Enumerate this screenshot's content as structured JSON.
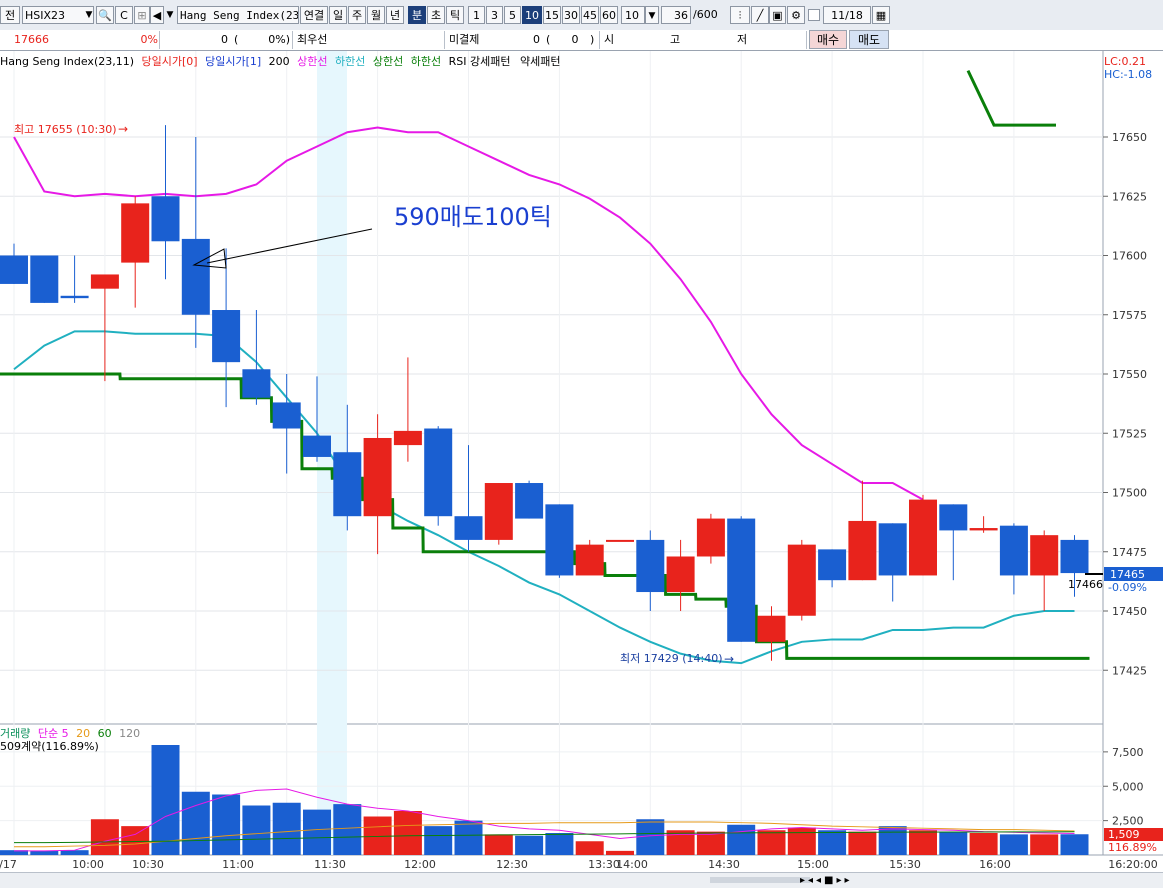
{
  "toolbar": {
    "left_label": "전",
    "code": "HSIX23",
    "instrument": "Hang Seng Index(23.1",
    "period_buttons": [
      "연결",
      "일",
      "주",
      "월",
      "년",
      "분",
      "초",
      "틱"
    ],
    "selected_period": "분",
    "interval_buttons": [
      "1",
      "3",
      "5",
      "10",
      "15",
      "30",
      "45",
      "60"
    ],
    "selected_interval": "10",
    "interval_value": "10",
    "count_value": "36",
    "count_total": "/600",
    "date_value": "11/18"
  },
  "quote_row": {
    "price": "17666",
    "change_pct": "0%",
    "volume": "0",
    "vol_pct_open": "(",
    "vol_pct": "0%)",
    "best_label": "최우선",
    "unsettled_label": "미결제",
    "unsettled_value": "0",
    "unsettled_paren_open": "(",
    "unsettled_paren_value": "0",
    "unsettled_paren_close": ")",
    "open_label": "시",
    "high_label": "고",
    "low_label": "저",
    "buy_button": "매수",
    "sell_button": "매도"
  },
  "legend": {
    "name": "Hang Seng Index(23,11)",
    "open0": "당일시가[0]",
    "open1": "당일시가[1]",
    "n200": "200",
    "upper1": "상한선",
    "lower1": "하한선",
    "upper2": "상한선",
    "lower2": "하한선",
    "rsi": "RSI 강세패턴",
    "weak": "약세패턴"
  },
  "right_info": {
    "lc": "LC:0.21",
    "hc": "HC:-1.08"
  },
  "annotations": {
    "high": "최고 17655 (10:30)",
    "low": "최저 17429 (14:40)",
    "arrow_note": "590매도100틱",
    "last_price_left": "17466",
    "last_price_tag": "17465",
    "last_change": "-0.09%"
  },
  "volume_legend": {
    "label": "거래량",
    "sma": "단순",
    "p5": "5",
    "p20": "20",
    "p60": "60",
    "p120": "120",
    "contract": "509계약(116.89%)",
    "tag_value": "1,509",
    "tag_pct": "116.89%"
  },
  "colors": {
    "up": "#e8231c",
    "down": "#1a5fd1",
    "upper_band": "#e619e6",
    "lower_band": "#20b0c0",
    "green_line": "#0a7f0a",
    "highlight": "#e6f7fd"
  },
  "chart_data": {
    "type": "candlestick",
    "y_axis": {
      "ticks": [
        "17650",
        "17625",
        "17600",
        "17575",
        "17550",
        "17525",
        "17500",
        "17475",
        "17450",
        "17425"
      ],
      "ylim": [
        17410,
        17680
      ]
    },
    "time_labels": [
      "/17",
      "10:00",
      "10:30",
      "11:00",
      "11:30",
      "12:00",
      "12:30",
      "13:30",
      "14:00",
      "14:30",
      "15:00",
      "15:30",
      "16:00",
      "16:20:00"
    ],
    "candles": [
      {
        "o": 17600,
        "h": 17605,
        "l": 17588,
        "c": 17588
      },
      {
        "o": 17600,
        "h": 17600,
        "l": 17580,
        "c": 17580
      },
      {
        "o": 17583,
        "h": 17600,
        "l": 17580,
        "c": 17582
      },
      {
        "o": 17586,
        "h": 17590,
        "l": 17547,
        "c": 17592
      },
      {
        "o": 17597,
        "h": 17625,
        "l": 17578,
        "c": 17622
      },
      {
        "o": 17625,
        "h": 17655,
        "l": 17590,
        "c": 17606
      },
      {
        "o": 17607,
        "h": 17650,
        "l": 17561,
        "c": 17575
      },
      {
        "o": 17577,
        "h": 17603,
        "l": 17536,
        "c": 17555
      },
      {
        "o": 17552,
        "h": 17577,
        "l": 17537,
        "c": 17540
      },
      {
        "o": 17538,
        "h": 17550,
        "l": 17508,
        "c": 17527
      },
      {
        "o": 17524,
        "h": 17549,
        "l": 17513,
        "c": 17515
      },
      {
        "o": 17517,
        "h": 17537,
        "l": 17484,
        "c": 17490
      },
      {
        "o": 17490,
        "h": 17533,
        "l": 17474,
        "c": 17523
      },
      {
        "o": 17520,
        "h": 17557,
        "l": 17513,
        "c": 17526
      },
      {
        "o": 17527,
        "h": 17528,
        "l": 17486,
        "c": 17490
      },
      {
        "o": 17490,
        "h": 17520,
        "l": 17475,
        "c": 17480
      },
      {
        "o": 17480,
        "h": 17504,
        "l": 17478,
        "c": 17504
      },
      {
        "o": 17504,
        "h": 17505,
        "l": 17489,
        "c": 17489
      },
      {
        "o": 17495,
        "h": 17495,
        "l": 17464,
        "c": 17465
      },
      {
        "o": 17465,
        "h": 17480,
        "l": 17466,
        "c": 17478
      },
      {
        "o": 17480,
        "h": 17480,
        "l": 17480,
        "c": 17480
      },
      {
        "o": 17480,
        "h": 17484,
        "l": 17450,
        "c": 17458
      },
      {
        "o": 17458,
        "h": 17480,
        "l": 17450,
        "c": 17473
      },
      {
        "o": 17473,
        "h": 17491,
        "l": 17470,
        "c": 17489
      },
      {
        "o": 17489,
        "h": 17490,
        "l": 17437,
        "c": 17437
      },
      {
        "o": 17437,
        "h": 17452,
        "l": 17429,
        "c": 17448
      },
      {
        "o": 17448,
        "h": 17480,
        "l": 17446,
        "c": 17478
      },
      {
        "o": 17476,
        "h": 17476,
        "l": 17460,
        "c": 17463
      },
      {
        "o": 17463,
        "h": 17505,
        "l": 17463,
        "c": 17488
      },
      {
        "o": 17487,
        "h": 17487,
        "l": 17454,
        "c": 17465
      },
      {
        "o": 17465,
        "h": 17499,
        "l": 17465,
        "c": 17497
      },
      {
        "o": 17495,
        "h": 17495,
        "l": 17463,
        "c": 17484
      },
      {
        "o": 17484,
        "h": 17490,
        "l": 17483,
        "c": 17485
      },
      {
        "o": 17486,
        "h": 17487,
        "l": 17457,
        "c": 17465
      },
      {
        "o": 17465,
        "h": 17484,
        "l": 17450,
        "c": 17482
      },
      {
        "o": 17480,
        "h": 17482,
        "l": 17456,
        "c": 17466
      }
    ],
    "upper_band": [
      17650,
      17627,
      17625,
      17626,
      17625,
      17626,
      17625,
      17626,
      17630,
      17640,
      17646,
      17652,
      17654,
      17652,
      17652,
      17646,
      17640,
      17634,
      17630,
      17624,
      17616,
      17605,
      17590,
      17572,
      17550,
      17533,
      17520,
      17512,
      17504,
      17504,
      17497
    ],
    "lower_band": [
      17552,
      17562,
      17568,
      17568,
      17567,
      17567,
      17567,
      17566,
      17555,
      17540,
      17525,
      17505,
      17495,
      17488,
      17482,
      17475,
      17469,
      17462,
      17457,
      17450,
      17443,
      17437,
      17432,
      17429,
      17428,
      17433,
      17437,
      17438,
      17438,
      17442,
      17442,
      17443,
      17443,
      17448,
      17450,
      17450
    ],
    "green_line": [
      17550,
      17550,
      17550,
      17550,
      17548,
      17548,
      17548,
      17548,
      17540,
      17530,
      17510,
      17506,
      17497,
      17485,
      17475,
      17475,
      17475,
      17475,
      17475,
      17470,
      17465,
      17465,
      17457,
      17455,
      17452,
      17437,
      17430,
      17430,
      17430,
      17430,
      17430,
      17430,
      17430,
      17430,
      17430,
      17430
    ],
    "green_line_top": {
      "from": 17678,
      "to": 17655
    },
    "highlight_bar_index": 10,
    "volume": {
      "ylim": [
        0,
        9000
      ],
      "ticks": [
        "7,500",
        "5,000",
        "2,500"
      ],
      "values": [
        350,
        300,
        350,
        2600,
        2100,
        8000,
        4600,
        4400,
        3600,
        3800,
        3300,
        3700,
        2800,
        3200,
        2100,
        2500,
        1500,
        1400,
        1600,
        1000,
        300,
        2600,
        1800,
        1700,
        2200,
        1800,
        2000,
        1800,
        1700,
        2100,
        1800,
        1700,
        1600,
        1500,
        1500,
        1509
      ],
      "ma5": [
        300,
        300,
        350,
        1000,
        1500,
        2800,
        3600,
        4300,
        4700,
        4800,
        4200,
        3700,
        3400,
        3200,
        2800,
        2500,
        2100,
        1900,
        1800,
        1500,
        1200,
        1400,
        1500,
        1500,
        1700,
        1900,
        2000,
        1900,
        1800,
        1900,
        1850,
        1800,
        1700,
        1650,
        1600,
        1560
      ],
      "ma20": [
        600,
        600,
        650,
        700,
        800,
        1000,
        1200,
        1400,
        1550,
        1700,
        1850,
        1950,
        2050,
        2150,
        2200,
        2250,
        2300,
        2300,
        2350,
        2350,
        2350,
        2400,
        2400,
        2400,
        2350,
        2300,
        2200,
        2100,
        2050,
        2000,
        1950,
        1900,
        1850,
        1850,
        1800,
        1750
      ],
      "ma60": [
        900,
        900,
        920,
        950,
        980,
        1000,
        1050,
        1100,
        1150,
        1200,
        1250,
        1300,
        1350,
        1400,
        1420,
        1440,
        1460,
        1480,
        1500,
        1520,
        1540,
        1560,
        1580,
        1600,
        1610,
        1620,
        1630,
        1640,
        1650,
        1660,
        1660,
        1670,
        1670,
        1680,
        1680,
        1690
      ]
    }
  }
}
